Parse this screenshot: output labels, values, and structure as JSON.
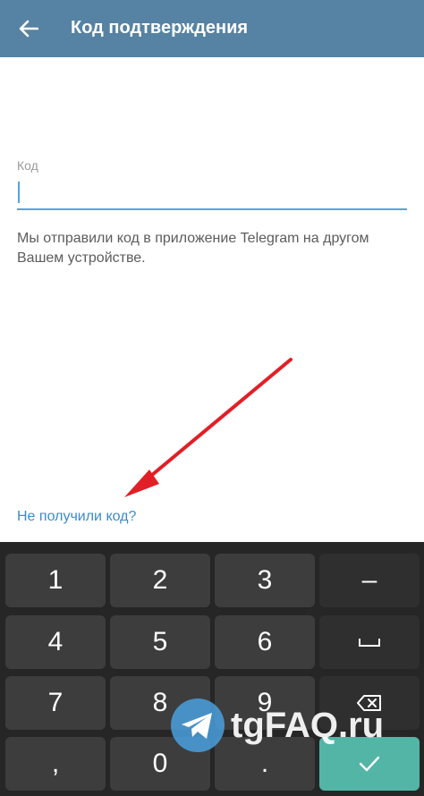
{
  "header": {
    "title": "Код подтверждения",
    "back_icon": "arrow-left-icon",
    "background": "#5682a3"
  },
  "code_field": {
    "label": "Код",
    "value": "",
    "accent": "#56a3de"
  },
  "info_text": "Мы отправили код в приложение Telegram на другом Вашем устройстве.",
  "resend_link": "Не получили код?",
  "annotation": {
    "icon": "red-arrow-icon",
    "color": "#e21f26"
  },
  "keypad": {
    "keys": {
      "k1": "1",
      "k2": "2",
      "k3": "3",
      "minus": "–",
      "k4": "4",
      "k5": "5",
      "k6": "6",
      "k7": "7",
      "k8": "8",
      "k9": "9",
      "comma": ",",
      "k0": "0",
      "dot": "."
    },
    "space_icon": "space-bar-icon",
    "backspace_icon": "backspace-icon",
    "done_icon": "checkmark-icon",
    "done_color": "#53b5a5"
  },
  "watermark": {
    "text": "tgFAQ.ru",
    "logo_icon": "telegram-logo-icon"
  }
}
